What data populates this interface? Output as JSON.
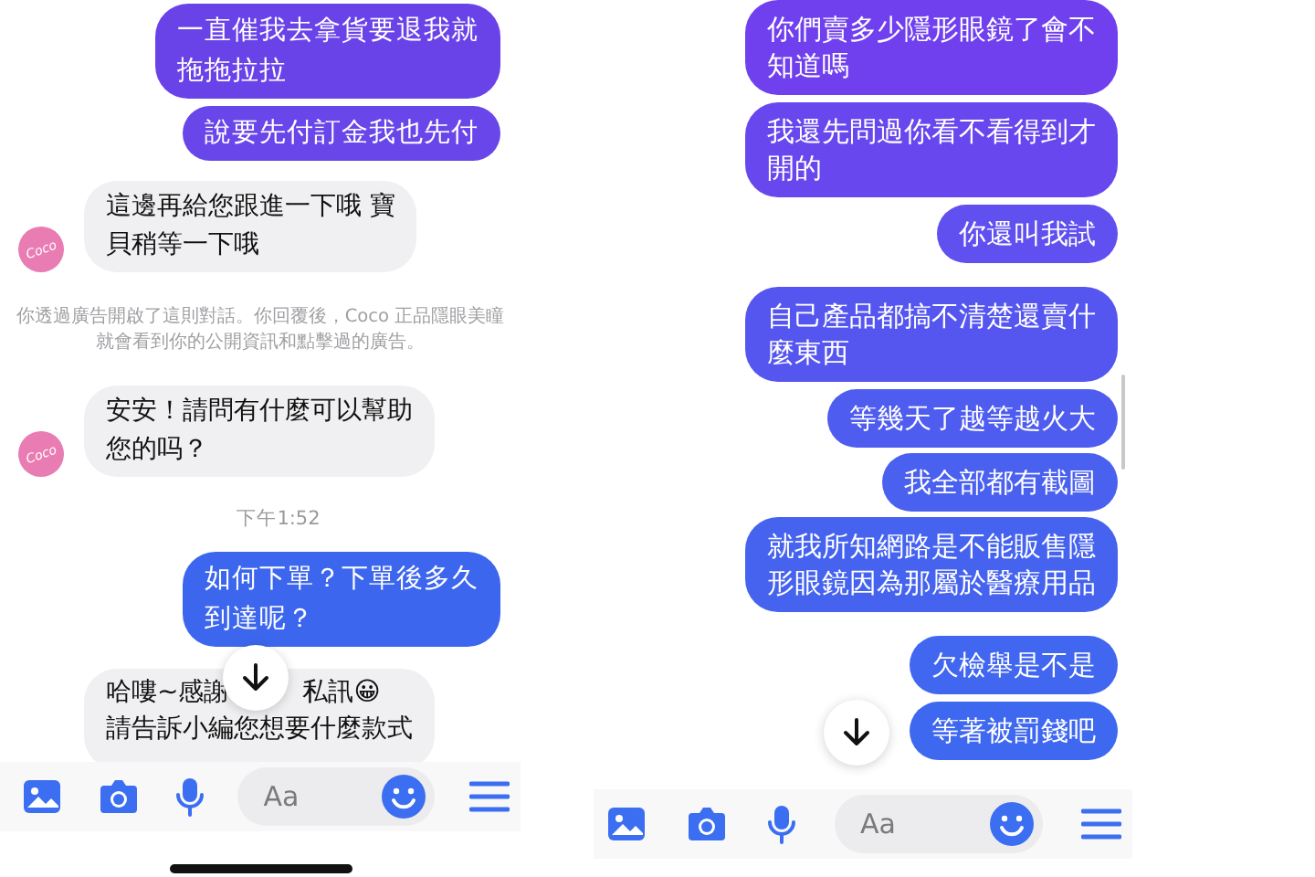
{
  "panels": [
    {
      "home_indicator": true,
      "messages": [
        {
          "kind": "sent",
          "color": "#6a43e8",
          "lines": [
            "一直催我去拿貨要退我就",
            "拖拖拉拉"
          ]
        },
        {
          "kind": "sent",
          "color": "#6946e9",
          "lines": [
            "說要先付訂金我也先付"
          ]
        },
        {
          "kind": "received",
          "avatar": true,
          "avatar_text": "Coco",
          "lines": [
            "這邊再給您跟進一下哦 寶",
            "貝稍等一下哦"
          ]
        },
        {
          "kind": "notice",
          "text": "你透過廣告開啟了這則對話。你回覆後，Coco 正品隱眼美瞳就會看到你的公開資訊和點擊過的廣告。"
        },
        {
          "kind": "received",
          "avatar": true,
          "avatar_text": "Coco",
          "lines": [
            "安安！請問有什麼可以幫助",
            "您的吗？"
          ]
        },
        {
          "kind": "time",
          "text": "下午1:52"
        },
        {
          "kind": "sent",
          "color": "#3c66ee",
          "lines": [
            "如何下單？下單後多久",
            "到達呢？"
          ]
        },
        {
          "kind": "received_split",
          "avatar": false,
          "parts": [
            "哈嘍~感謝",
            "私訊😀",
            "請告訴小編您想要什麼款式"
          ]
        }
      ],
      "composer": {
        "placeholder": "Aa"
      }
    },
    {
      "home_indicator": false,
      "messages": [
        {
          "kind": "sent",
          "color": "#7040ee",
          "lines": [
            "你們賣多少隱形眼鏡了會不",
            "知道嗎"
          ]
        },
        {
          "kind": "sent",
          "color": "#6848ee",
          "lines": [
            "我還先問過你看不看得到才",
            "開的"
          ]
        },
        {
          "kind": "sent",
          "color": "#6050ef",
          "lines": [
            "你還叫我試"
          ]
        },
        {
          "kind": "sent",
          "color": "#5556ef",
          "lines": [
            "自己產品都搞不清楚還賣什",
            "麼東西"
          ]
        },
        {
          "kind": "sent",
          "color": "#4e5cef",
          "lines": [
            "等幾天了越等越火大"
          ]
        },
        {
          "kind": "sent",
          "color": "#4a60ef",
          "lines": [
            "我全部都有截圖"
          ]
        },
        {
          "kind": "sent",
          "color": "#4563ef",
          "lines": [
            "就我所知網路是不能販售隱",
            "形眼鏡因為那屬於醫療用品"
          ]
        },
        {
          "kind": "sent",
          "color": "#4166ef",
          "lines": [
            "欠檢舉是不是"
          ]
        },
        {
          "kind": "sent",
          "color": "#3e68ef",
          "lines": [
            "等著被罰錢吧"
          ]
        }
      ],
      "composer": {
        "placeholder": "Aa"
      }
    }
  ]
}
